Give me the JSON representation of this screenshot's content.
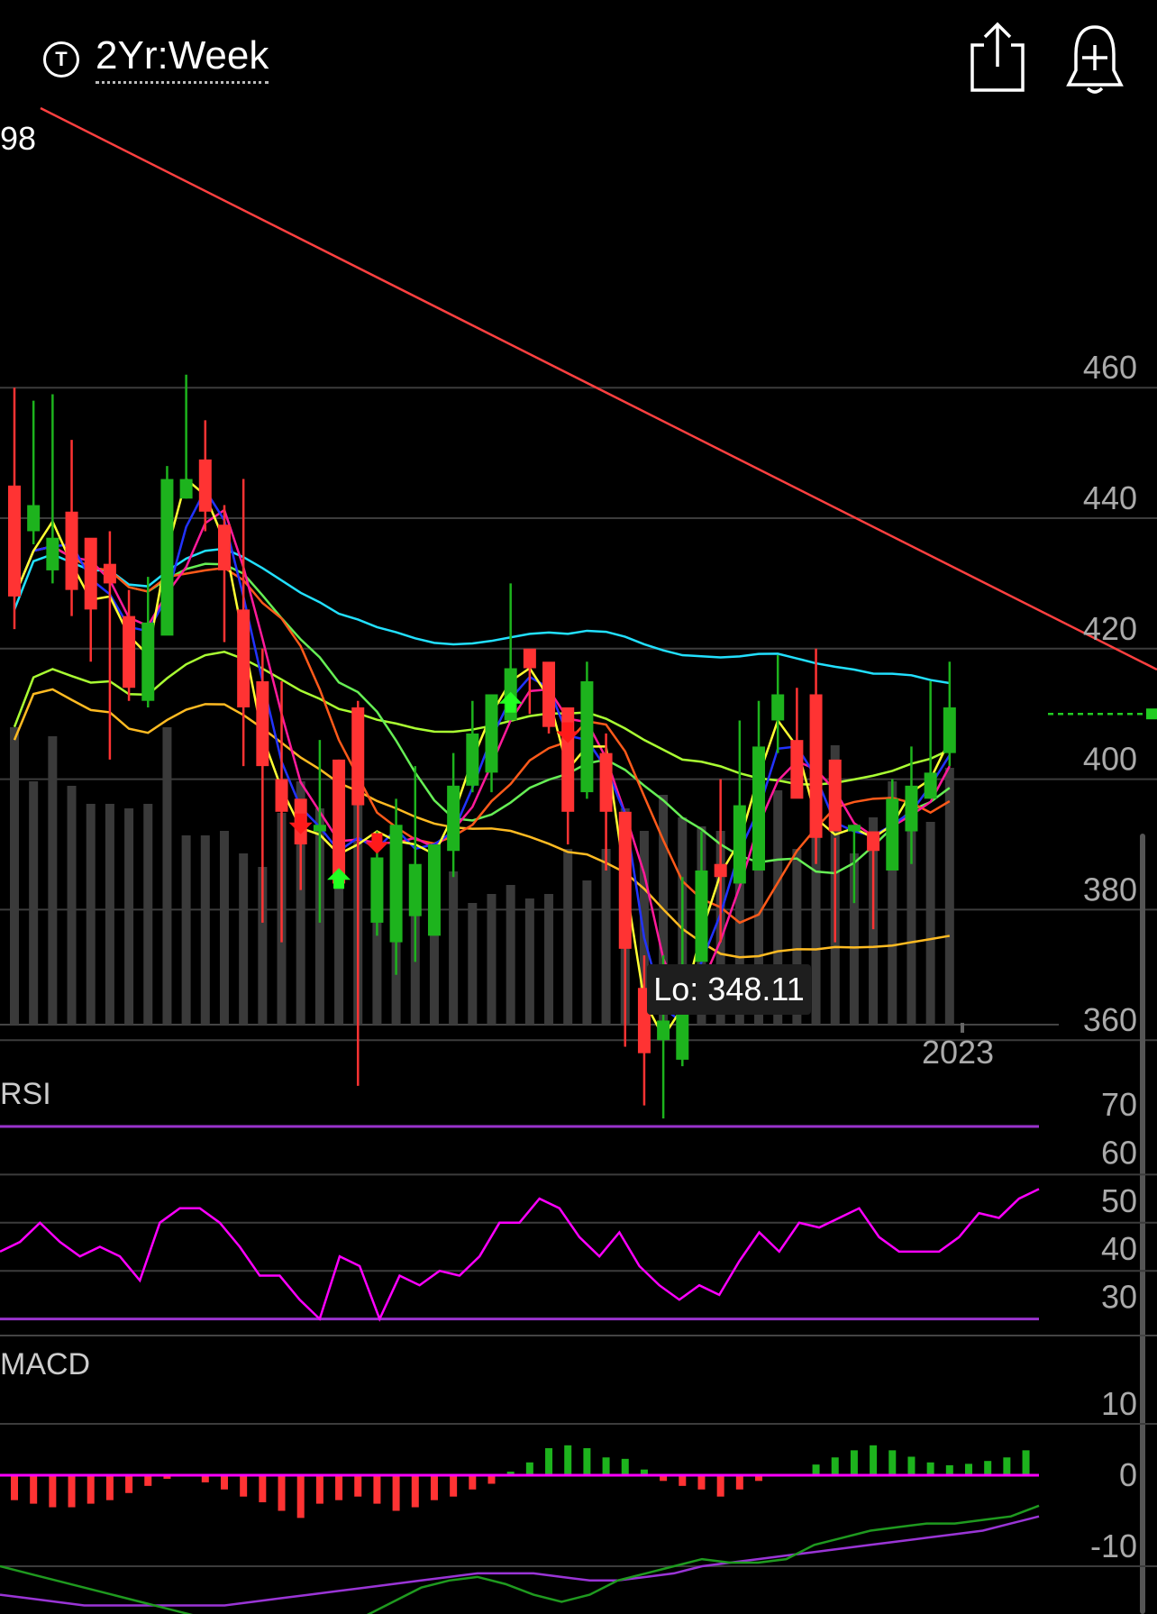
{
  "header": {
    "ticker_icon": "T",
    "period_label": "2Yr:Week",
    "share_icon": "share-icon",
    "alert_icon": "add-alert-bell-icon"
  },
  "price_panel": {
    "edge_label": "98",
    "y_ticks": [
      460,
      440,
      420,
      400,
      380,
      360
    ],
    "x_label": "2023",
    "low_label": "Lo: 348.11"
  },
  "rsi_panel": {
    "label": "RSI",
    "y_ticks": [
      70,
      60,
      50,
      40,
      30
    ]
  },
  "macd_panel": {
    "label": "MACD",
    "y_ticks": [
      10,
      0,
      -10
    ]
  },
  "colors": {
    "up": "#1db31d",
    "down": "#ff3333",
    "trendline": "#ff4040",
    "rsi": "#ff00ff",
    "rsi_band": "#9933cc",
    "macd_line": "#1f9a1f",
    "macd_signal": "#9a35d6",
    "zero": "#ff00ff",
    "volume": "#3a3a3a",
    "ma_yellow": "#ffff33",
    "ma_blue": "#2233ff",
    "ma_magenta": "#ff1a9a",
    "ma_orange": "#ff5a1a",
    "ma_lightgreen": "#66ee55",
    "ma_lime": "#aaff33",
    "ma_cyan": "#22e0ff",
    "ma_gold": "#ffbb22"
  },
  "chart_data": [
    {
      "type": "candlestick",
      "ylim": [
        340,
        470
      ],
      "open": [
        445,
        438,
        432,
        441,
        437,
        433,
        425,
        412,
        422,
        443,
        449,
        439,
        426,
        415,
        400,
        397,
        392,
        403,
        411,
        378,
        375,
        379,
        376,
        389,
        399,
        401,
        409,
        420,
        418,
        411,
        398,
        404,
        395,
        368,
        360,
        357,
        372,
        387,
        384,
        386,
        409,
        406,
        413,
        403,
        392,
        392,
        386,
        392,
        397,
        404
      ],
      "close": [
        428,
        442,
        437,
        429,
        426,
        430,
        414,
        424,
        446,
        446,
        441,
        432,
        411,
        402,
        395,
        390,
        393,
        384,
        396,
        388,
        393,
        387,
        390,
        399,
        407,
        413,
        417,
        417,
        408,
        395,
        415,
        395,
        374,
        358,
        363,
        367,
        386,
        385,
        396,
        405,
        413,
        397,
        391,
        392,
        393,
        389,
        397,
        399,
        401,
        411
      ],
      "high": [
        460,
        458,
        459,
        452,
        433,
        438,
        429,
        431,
        448,
        462,
        455,
        442,
        446,
        420,
        415,
        395,
        406,
        403,
        412,
        392,
        397,
        402,
        387,
        404,
        412,
        411,
        430,
        419,
        412,
        409,
        418,
        407,
        388,
        373,
        373,
        385,
        392,
        400,
        409,
        412,
        419,
        414,
        420,
        391,
        393,
        392,
        400,
        405,
        415,
        418
      ],
      "low": [
        423,
        436,
        430,
        425,
        418,
        403,
        412,
        411,
        423,
        443,
        438,
        421,
        402,
        378,
        375,
        383,
        378,
        385,
        353,
        376,
        370,
        372,
        382,
        385,
        398,
        398,
        412,
        410,
        407,
        390,
        397,
        386,
        359,
        350,
        348,
        356,
        377,
        375,
        389,
        405,
        404,
        401,
        387,
        375,
        381,
        377,
        392,
        387,
        397,
        402
      ],
      "volume": [
        330,
        270,
        320,
        265,
        245,
        245,
        240,
        245,
        330,
        210,
        210,
        215,
        190,
        175,
        235,
        270,
        240,
        165,
        260,
        145,
        170,
        160,
        145,
        170,
        135,
        145,
        155,
        140,
        145,
        195,
        160,
        195,
        240,
        215,
        255,
        230,
        220,
        215,
        240,
        210,
        260,
        195,
        220,
        310,
        190,
        230,
        270,
        245,
        225,
        285
      ],
      "volume_units": "relative",
      "x_label": "2023",
      "low_annotation": 348.11,
      "signals_down": [
        15,
        19,
        29
      ],
      "signals_up": [
        17,
        26
      ],
      "dashed_last_price": 410
    },
    {
      "type": "line",
      "name": "RSI",
      "ylim": [
        25,
        75
      ],
      "bands": [
        70,
        30
      ],
      "values": [
        44,
        46,
        50,
        46,
        43,
        45,
        43,
        38,
        50,
        53,
        53,
        50,
        45,
        39,
        39,
        34,
        30,
        43,
        41,
        30,
        39,
        37,
        40,
        39,
        43,
        50,
        50,
        55,
        53,
        47,
        43,
        48,
        41,
        37,
        34,
        37,
        35,
        42,
        48,
        44,
        50,
        49,
        51,
        53,
        47,
        44,
        44,
        44,
        47,
        52,
        51,
        55,
        57
      ]
    },
    {
      "type": "line",
      "name": "MACD",
      "ylim": [
        -20,
        14
      ],
      "line": [
        -10,
        -11,
        -12,
        -13,
        -14,
        -15,
        -16,
        -17,
        -18,
        -19,
        -19.5,
        -20,
        -19,
        -17,
        -15,
        -13,
        -12,
        -11.5,
        -12.5,
        -14,
        -15,
        -14,
        -12,
        -11,
        -10,
        -9,
        -9.5,
        -9.5,
        -9,
        -7,
        -6,
        -5,
        -4.5,
        -4,
        -4,
        -3.5,
        -3,
        -1.5
      ],
      "signal": [
        -14,
        -14.5,
        -15,
        -15.5,
        -15.5,
        -15.5,
        -15.5,
        -15.5,
        -15.5,
        -15,
        -14.5,
        -14,
        -13.5,
        -13,
        -12.5,
        -12,
        -11.5,
        -11,
        -11,
        -11,
        -11.5,
        -12,
        -12,
        -11.5,
        -11,
        -10,
        -9.5,
        -9,
        -8.5,
        -8,
        -7.5,
        -7,
        -6.5,
        -6,
        -5.5,
        -5,
        -4,
        -3
      ],
      "histogram": [
        -3.5,
        -4.0,
        -4.5,
        -4.5,
        -4.0,
        -3.5,
        -2.5,
        -1.5,
        -0.5,
        0,
        -1.0,
        -2.0,
        -3.0,
        -3.8,
        -5.0,
        -6.0,
        -4.0,
        -3.5,
        -3.0,
        -4.0,
        -5.0,
        -4.5,
        -3.5,
        -3.0,
        -2.0,
        -1.2,
        0.5,
        1.8,
        3.8,
        4.2,
        3.8,
        2.5,
        2.3,
        0.8,
        -0.8,
        -1.5,
        -2.0,
        -3.0,
        -2.0,
        -0.8,
        0,
        0,
        1.5,
        2.5,
        3.5,
        4.2,
        3.5,
        2.6,
        1.8,
        1.4,
        1.6,
        2.0,
        2.5,
        3.5
      ]
    }
  ]
}
